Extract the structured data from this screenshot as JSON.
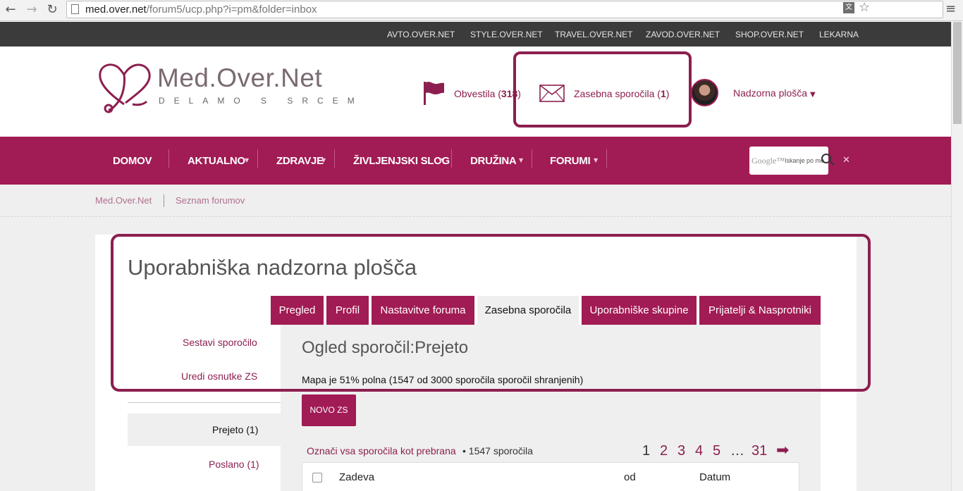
{
  "browser": {
    "url_host": "med.over.net",
    "url_path": "/forum5/ucp.php?i=pm&folder=inbox"
  },
  "network_links": [
    "AVTO.OVER.NET",
    "STYLE.OVER.NET",
    "TRAVEL.OVER.NET",
    "ZAVOD.OVER.NET",
    "SHOP.OVER.NET",
    "LEKARNA"
  ],
  "header": {
    "logo_name": "Med.Over.Net",
    "logo_tagline": "DELAMO S SRCEM",
    "notifications_label": "Obvestila (",
    "notifications_count": "318",
    "notifications_close": ")",
    "pm_label": "Zasebna sporočila (",
    "pm_count": "1",
    "pm_close": ")",
    "dashboard_label": "Nadzorna plošča"
  },
  "main_nav": [
    "DOMOV",
    "AKTUALNO",
    "ZDRAVJE",
    "ŽIVLJENJSKI SLOG",
    "DRUŽINA",
    "FORUMI"
  ],
  "search": {
    "google": "Google™",
    "placeholder": "Iskanje po me"
  },
  "breadcrumb": [
    "Med.Over.Net",
    "Seznam forumov"
  ],
  "page_title": "Uporabniška nadzorna plošča",
  "tabs": [
    "Pregled",
    "Profil",
    "Nastavitve foruma",
    "Zasebna sporočila",
    "Uporabniške skupine",
    "Prijatelji & Nasprotniki"
  ],
  "sidebar": {
    "compose": "Sestavi sporočilo",
    "drafts": "Uredi osnutke ZS",
    "inbox": "Prejeto (1)",
    "sent": "Poslano (1)"
  },
  "content": {
    "heading": "Ogled sporočil:Prejeto",
    "folder_info": "Mapa je 51% polna (1547 od 3000 sporočila sporočil shranjenih)",
    "new_pm_button": "NOVO ZS",
    "mark_all_read": "Označi vsa sporočila kot prebrana",
    "message_count": "• 1547 sporočila",
    "pagination": [
      "1",
      "2",
      "3",
      "4",
      "5",
      "…",
      "31"
    ],
    "table_headers": {
      "subject": "Zadeva",
      "from": "od",
      "date": "Datum"
    }
  },
  "colors": {
    "brand": "#a11b54",
    "accent_text": "#8c1f4f",
    "network_bar": "#3b3b3b"
  }
}
